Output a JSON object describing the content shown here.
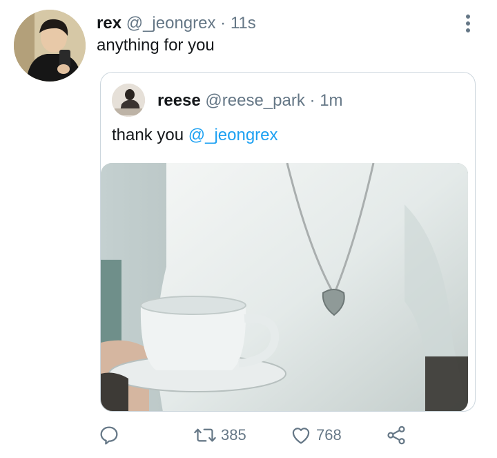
{
  "tweet": {
    "author_name": "rex",
    "author_handle": "@_jeongrex",
    "separator": "·",
    "time": "11s",
    "text": "anything for you"
  },
  "quoted_tweet": {
    "author_name": "reese",
    "author_handle": "@reese_park",
    "separator": "·",
    "time": "1m",
    "text": "thank you",
    "mention": "@_jeongrex"
  },
  "actions": {
    "retweet_count": "385",
    "like_count": "768"
  },
  "icons": {
    "reply": "reply-icon",
    "retweet": "retweet-icon",
    "like": "heart-icon",
    "share": "share-icon",
    "more": "more-vertical-icon"
  },
  "colors": {
    "link": "#1da1f2",
    "muted": "#657786",
    "border": "#ccd6dd"
  }
}
